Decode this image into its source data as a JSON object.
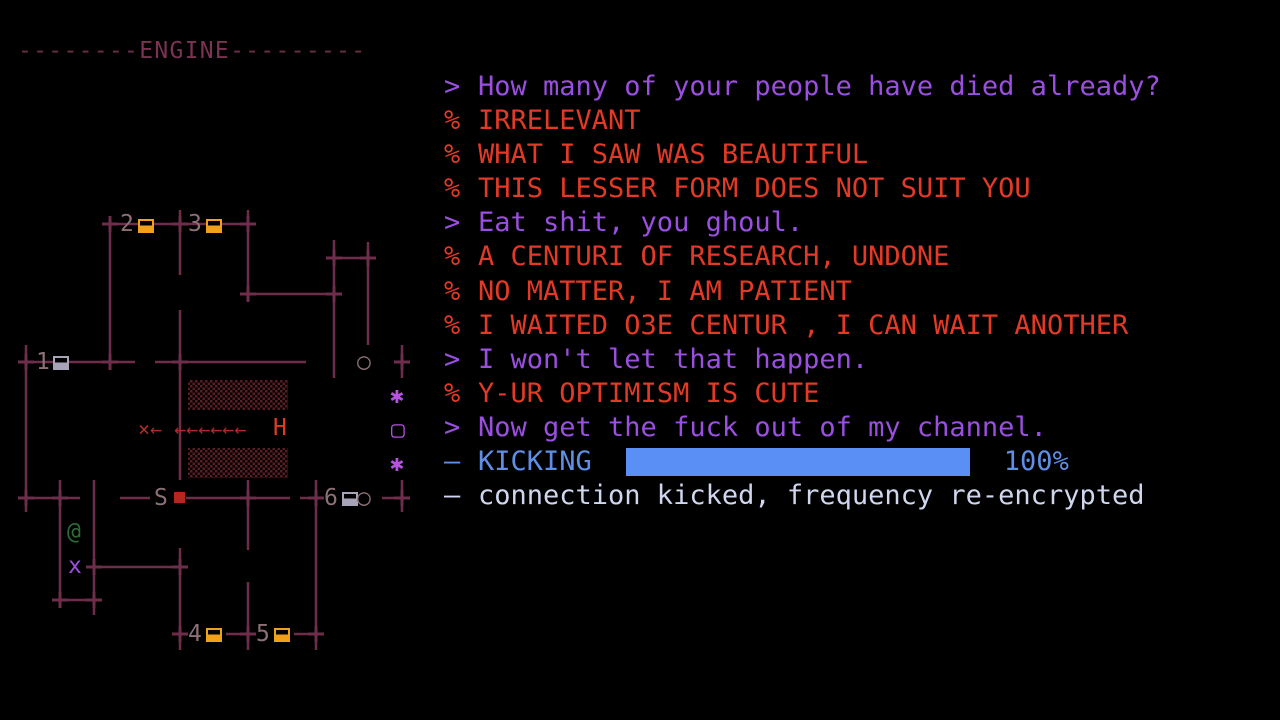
{
  "map": {
    "title_left": "--------",
    "title": "ENGINE",
    "title_right": "---------",
    "rooms": [
      {
        "id": "1",
        "door": "grey"
      },
      {
        "id": "2",
        "door": "amber"
      },
      {
        "id": "3",
        "door": "amber"
      },
      {
        "id": "4",
        "door": "amber"
      },
      {
        "id": "5",
        "door": "amber"
      },
      {
        "id": "6",
        "door": "grey"
      }
    ],
    "start_label": "S",
    "hostile_label": "H",
    "hostile_trail": "×← ←←←←←←",
    "player_symbol": "@",
    "crew_symbol": "x",
    "side_icons": [
      "✱",
      "▢",
      "✱"
    ],
    "node_symbol": "○"
  },
  "log": [
    {
      "prefix": ">",
      "text": "How many of your people have died already?",
      "speaker": "user"
    },
    {
      "prefix": "%",
      "text": "IRRELEVANT",
      "speaker": "alien"
    },
    {
      "prefix": "%",
      "text": "WHAT I SAW WAS BEAUTIFUL",
      "speaker": "alien"
    },
    {
      "prefix": "%",
      "text": "THIS LESSER FORM DOES NOT SUIT YOU",
      "speaker": "alien"
    },
    {
      "prefix": ">",
      "text": "Eat shit, you ghoul.",
      "speaker": "user"
    },
    {
      "prefix": "%",
      "text": "A CENTURI OF RESEARCH, UNDONE",
      "speaker": "alien"
    },
    {
      "prefix": "%",
      "text": "NO MATTER, I AM PATIENT",
      "speaker": "alien"
    },
    {
      "prefix": "%",
      "text": "I WAITED O3E CENTUR , I CAN WAIT ANOTHER",
      "speaker": "alien"
    },
    {
      "prefix": ">",
      "text": "I won't let that happen.",
      "speaker": "user"
    },
    {
      "prefix": "%",
      "text": "Y-UR OPTIMISM IS CUTE",
      "speaker": "alien"
    },
    {
      "prefix": ">",
      "text": "Now get the fuck out of my channel.",
      "speaker": "user"
    }
  ],
  "progress": {
    "prefix": "—",
    "label": "KICKING",
    "value": 1.0,
    "percent_text": "100%"
  },
  "status": {
    "prefix": "—",
    "text": "connection kicked, frequency re-encrypted"
  },
  "colors": {
    "user": "#9a4fe0",
    "alien": "#e23a26",
    "system": "#5f8ee6",
    "note": "#cfd6ee",
    "wall": "#6e2e4b",
    "amber": "#f2a01a",
    "hostile": "#e23a26"
  }
}
